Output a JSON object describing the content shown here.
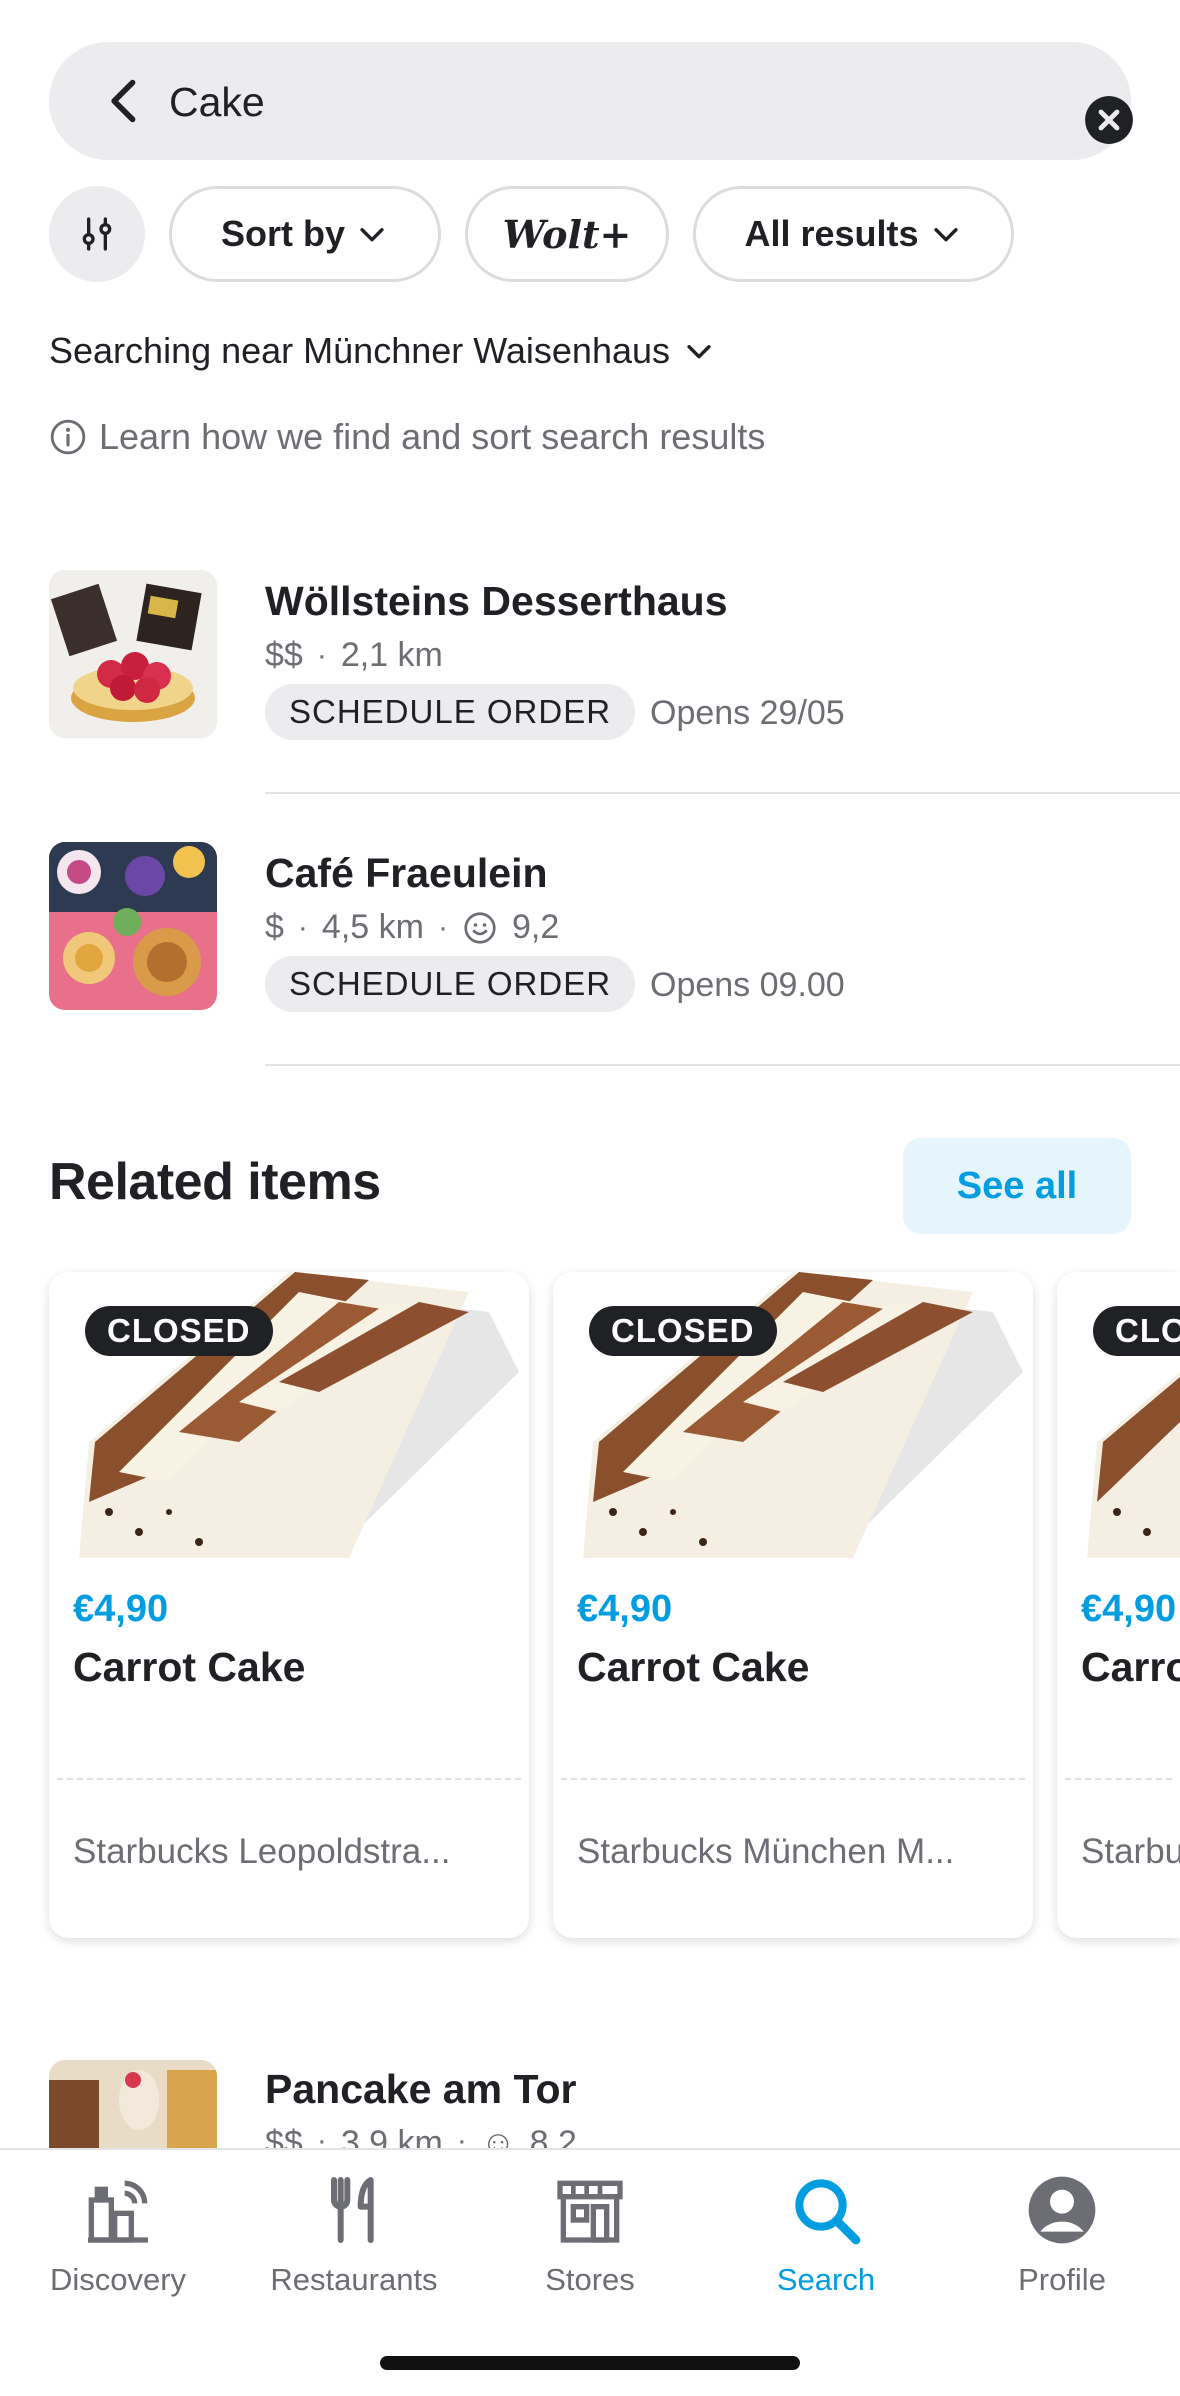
{
  "search": {
    "query": "Cake"
  },
  "filters": {
    "sort_label": "Sort by",
    "woltplus_label": "Wolt+",
    "results_label": "All results"
  },
  "location": {
    "text": "Searching near Münchner Waisenhaus"
  },
  "learn_more": {
    "text": "Learn how we find and sort search results"
  },
  "venues": [
    {
      "name": "Wöllsteins Desserthaus",
      "price": "$$",
      "distance": "2,1 km",
      "rating": "",
      "schedule_label": "SCHEDULE ORDER",
      "opens": "Opens 29/05"
    },
    {
      "name": "Café Fraeulein",
      "price": "$",
      "distance": "4,5 km",
      "rating": "9,2",
      "schedule_label": "SCHEDULE ORDER",
      "opens": "Opens 09.00"
    },
    {
      "name": "Pancake am Tor",
      "price": "$$",
      "distance": "3,9 km",
      "rating": "8,2"
    }
  ],
  "related": {
    "title": "Related items",
    "see_all": "See all",
    "items": [
      {
        "badge": "CLOSED",
        "price": "€4,90",
        "name": "Carrot Cake",
        "store": "Starbucks Leopoldstra..."
      },
      {
        "badge": "CLOSED",
        "price": "€4,90",
        "name": "Carrot Cake",
        "store": "Starbucks München M..."
      },
      {
        "badge": "CLOSED",
        "price": "€4,90",
        "name": "Carrot Cake",
        "store": "Starbucks"
      }
    ]
  },
  "nav": {
    "items": [
      {
        "label": "Discovery"
      },
      {
        "label": "Restaurants"
      },
      {
        "label": "Stores"
      },
      {
        "label": "Search",
        "active": true
      },
      {
        "label": "Profile"
      }
    ]
  },
  "colors": {
    "accent": "#009de0",
    "text": "#202125",
    "muted": "#6d6e73",
    "chip_bg": "#ececee"
  }
}
